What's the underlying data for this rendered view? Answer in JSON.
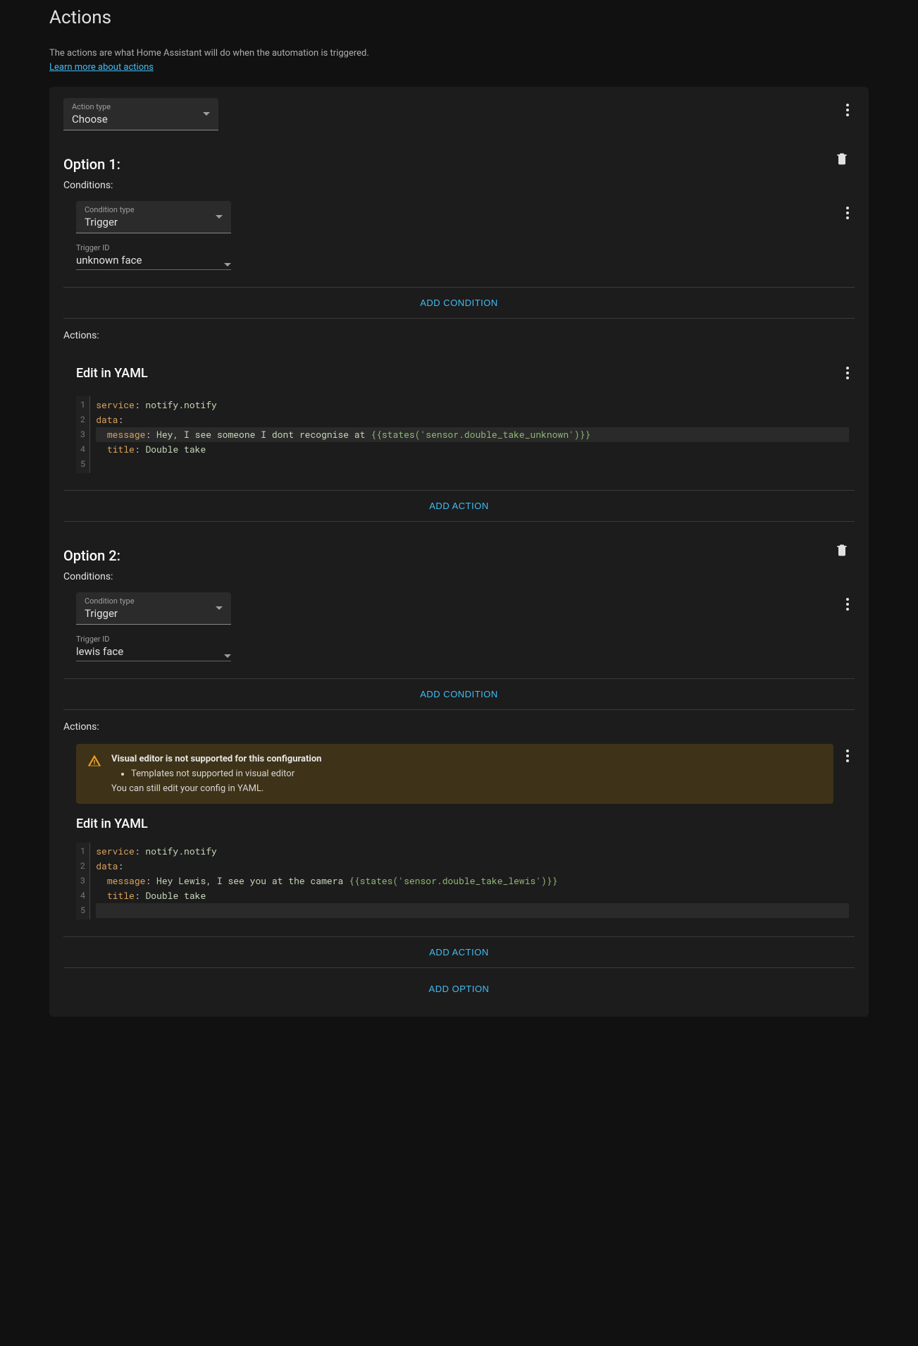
{
  "header": {
    "title": "Actions",
    "description": "The actions are what Home Assistant will do when the automation is triggered.",
    "learn_more": "Learn more about actions"
  },
  "action_type": {
    "label": "Action type",
    "value": "Choose"
  },
  "buttons": {
    "add_condition": "ADD CONDITION",
    "add_action": "ADD ACTION",
    "add_option": "ADD OPTION"
  },
  "labels": {
    "conditions": "Conditions:",
    "actions": "Actions:",
    "edit_yaml": "Edit in YAML",
    "condition_type": "Condition type",
    "trigger_id": "Trigger ID"
  },
  "warning": {
    "title": "Visual editor is not supported for this configuration",
    "item": "Templates not supported in visual editor",
    "foot": "You can still edit your config in YAML."
  },
  "options": [
    {
      "title": "Option 1:",
      "condition_value": "Trigger",
      "trigger_id": "unknown face",
      "yaml": {
        "service_key": "service",
        "service_val": "notify.notify",
        "data_key": "data",
        "message_key": "message",
        "message_val_pre": "Hey, I see someone I dont recognise at ",
        "message_template": "{{states('sensor.double_take_unknown')}}",
        "title_key": "title",
        "title_val": "Double take"
      },
      "warning": false
    },
    {
      "title": "Option 2:",
      "condition_value": "Trigger",
      "trigger_id": "lewis face",
      "yaml": {
        "service_key": "service",
        "service_val": "notify.notify",
        "data_key": "data",
        "message_key": "message",
        "message_val_pre": "Hey Lewis, I see you at the camera ",
        "message_template": "{{states('sensor.double_take_lewis')}}",
        "title_key": "title",
        "title_val": "Double take"
      },
      "warning": true
    }
  ]
}
